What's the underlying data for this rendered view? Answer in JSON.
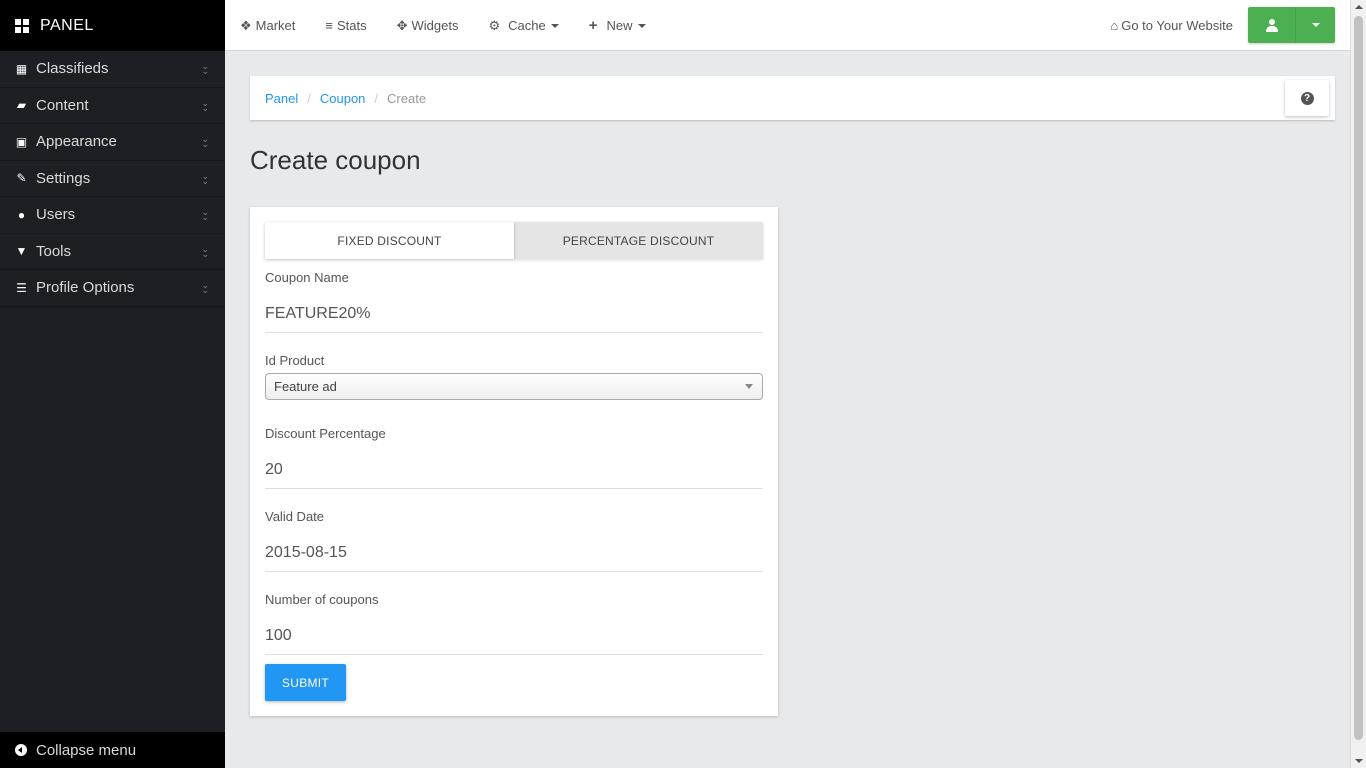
{
  "sidebar": {
    "brand": "PANEL",
    "items": [
      {
        "label": "Classifieds",
        "icon": "grid-icon"
      },
      {
        "label": "Content",
        "icon": "folder-open-icon"
      },
      {
        "label": "Appearance",
        "icon": "image-icon"
      },
      {
        "label": "Settings",
        "icon": "wrench-icon"
      },
      {
        "label": "Users",
        "icon": "user-icon"
      },
      {
        "label": "Tools",
        "icon": "filter-icon"
      },
      {
        "label": "Profile Options",
        "icon": "list-icon"
      }
    ],
    "collapse_label": "Collapse menu"
  },
  "topbar": {
    "items": [
      {
        "label": "Market",
        "icon": "cubes-icon"
      },
      {
        "label": "Stats",
        "icon": "bars-icon"
      },
      {
        "label": "Widgets",
        "icon": "move-icon"
      },
      {
        "label": "Cache",
        "icon": "gear-icon",
        "dropdown": true
      },
      {
        "label": "New",
        "icon": "plus-icon",
        "dropdown": true
      }
    ],
    "goto_label": "Go to Your Website",
    "user_button_color": "#4caf50"
  },
  "breadcrumb": {
    "items": [
      "Panel",
      "Coupon"
    ],
    "current": "Create",
    "separator": "/"
  },
  "page_title": "Create coupon",
  "form": {
    "tabs": [
      {
        "label": "FIXED DISCOUNT",
        "active": true
      },
      {
        "label": "PERCENTAGE DISCOUNT",
        "active": false
      }
    ],
    "coupon_name": {
      "label": "Coupon Name",
      "value": "FEATURE20%"
    },
    "id_product": {
      "label": "Id Product",
      "value": "Feature ad"
    },
    "discount_percentage": {
      "label": "Discount Percentage",
      "value": "20"
    },
    "valid_date": {
      "label": "Valid Date",
      "value": "2015-08-15"
    },
    "number_of_coupons": {
      "label": "Number of coupons",
      "value": "100"
    },
    "submit_label": "SUBMIT"
  },
  "colors": {
    "sidebar_bg": "#1d1f24",
    "accent_blue": "#2196f3",
    "success_green": "#4caf50",
    "page_bg": "#e7e9eb"
  }
}
